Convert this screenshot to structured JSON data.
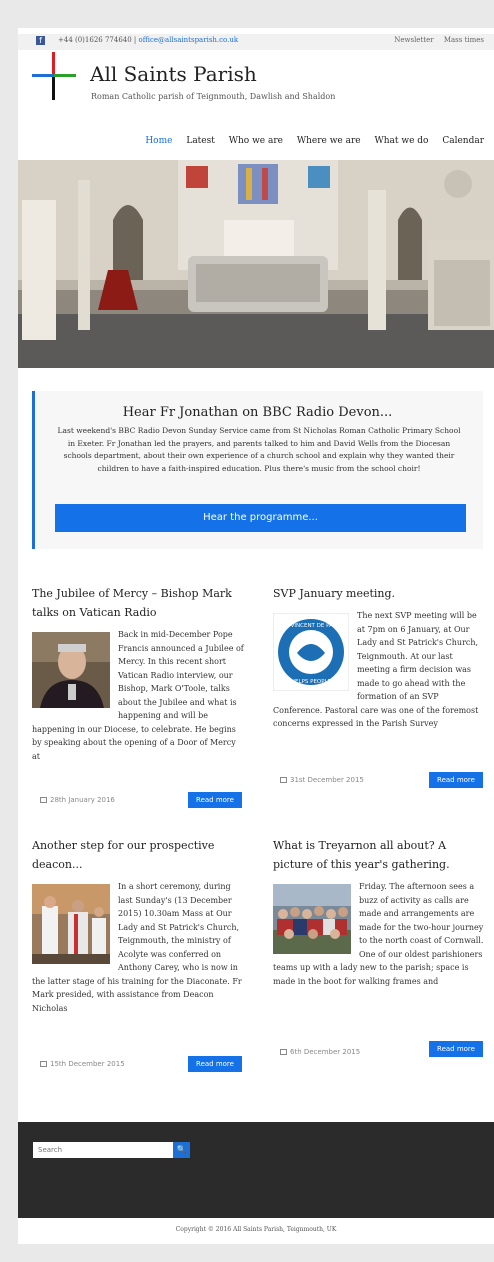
{
  "topbar": {
    "facebook_glyph": "f",
    "phone": "+44 (0)1626 774640",
    "separator": "|",
    "email": "office@allsaintsparish.co.uk",
    "links": [
      "Newsletter",
      "Mass times"
    ]
  },
  "header": {
    "title": "All Saints Parish",
    "subtitle": "Roman Catholic parish of Teignmouth, Dawlish and Shaldon"
  },
  "nav": {
    "items": [
      "Home",
      "Latest",
      "Who we are",
      "Where we are",
      "What we do",
      "Calendar"
    ],
    "active": "Home"
  },
  "notice": {
    "title": "Hear Fr Jonathan on BBC Radio Devon...",
    "body": "Last weekend's BBC Radio Devon Sunday Service came from St Nicholas Roman Catholic Primary School in Exeter. Fr Jonathan led the prayers, and parents talked to him and David Wells from the Diocesan schools department, about their own experience of a church school and explain why they wanted their children to have a faith-inspired education. Plus there's music from the school choir!",
    "button": "Hear the programme..."
  },
  "posts": [
    {
      "title": "The Jubilee of Mercy – Bishop Mark talks on Vatican Radio",
      "body": "Back in mid-December Pope Francis announced a Jubilee of Mercy. In this recent short Vatican Radio interview, our Bishop, Mark O'Toole, talks about the Jubilee and what is happening and will be happening in our Diocese, to celebrate. He begins by speaking about the opening of a Door of Mercy at",
      "date": "28th January 2016",
      "read_more": "Read more"
    },
    {
      "title": "SVP January meeting.",
      "body": "The next SVP meeting will be at 7pm on 6 January, at Our Lady and St Patrick's Church, Teignmouth. At our last meeting a firm decision was made to go ahead with the formation of an SVP Conference. Pastoral care was one of the foremost concerns expressed in the Parish Survey",
      "date": "31st December 2015",
      "read_more": "Read more",
      "logo_text_top": "ST VINCENT DE PAUL",
      "logo_text_bottom": "HELPS PEOPLE"
    },
    {
      "title": "Another step for our prospective deacon...",
      "body": "In a short ceremony, during last Sunday's (13 December 2015) 10.30am Mass at Our Lady and St Patrick's Church, Teignmouth, the ministry of Acolyte was conferred on Anthony Carey, who is now in the latter stage of his training for the Diaconate. Fr Mark presided, with assistance from Deacon Nicholas",
      "date": "15th December 2015",
      "read_more": "Read more"
    },
    {
      "title": "What is Treyarnon all about? A picture of this year's gathering.",
      "body": "Friday. The afternoon sees a buzz of activity as calls are made and arrangements are made for the two-hour journey to the north coast of Cornwall. One of our oldest parishioners teams up with a lady new to the parish; space is made in the boot for walking frames and",
      "date": "6th December 2015",
      "read_more": "Read more"
    }
  ],
  "footer": {
    "search_placeholder": "Search",
    "search_glyph": "🔍",
    "copyright": "Copyright © 2016 All Saints Parish, Teignmouth, UK"
  },
  "colors": {
    "accent": "#1571e8",
    "link": "#1d6fd6",
    "footer": "#2b2b2b"
  }
}
